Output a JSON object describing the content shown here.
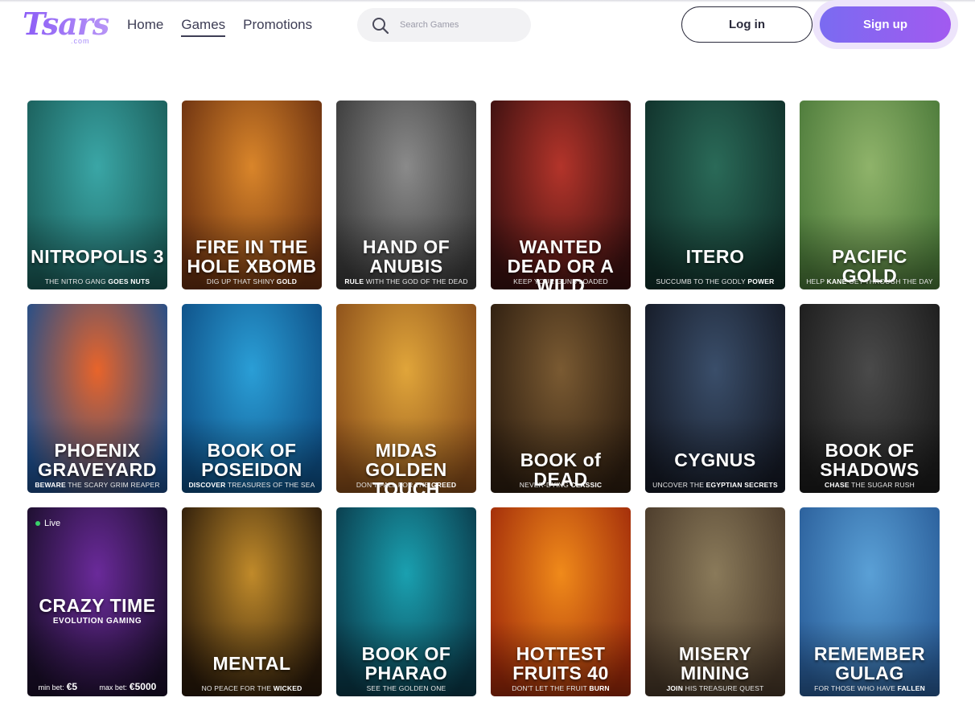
{
  "header": {
    "logo": {
      "text": "Tsars",
      "sub": ".com"
    },
    "nav": [
      {
        "label": "Home",
        "active": false
      },
      {
        "label": "Games",
        "active": true
      },
      {
        "label": "Promotions",
        "active": false
      }
    ],
    "search": {
      "placeholder": "Search Games",
      "icon": "search-icon"
    },
    "login_label": "Log in",
    "signup_label": "Sign up"
  },
  "colors": {
    "accent": "#8b5cf6",
    "signup_start": "#7a6bf1",
    "signup_end": "#a25af0"
  },
  "games": [
    {
      "title": "NITROPOLIS 3",
      "tag_pre": "THE NITRO GANG ",
      "tag_bold": "GOES NUTS",
      "tag_post": "",
      "bg1": "#3aa6a6",
      "bg2": "#1b5e5a"
    },
    {
      "title": "FIRE IN THE HOLE XBOMB",
      "tag_pre": "DIG UP THAT SHINY ",
      "tag_bold": "GOLD",
      "tag_post": "",
      "bg1": "#d9852a",
      "bg2": "#6a3010"
    },
    {
      "title": "HAND OF ANUBIS",
      "tag_pre": "",
      "tag_bold": "RULE",
      "tag_post": " WITH THE GOD OF THE DEAD",
      "bg1": "#8a8a8a",
      "bg2": "#3a3a3a"
    },
    {
      "title": "WANTED DEAD OR A WILD",
      "tag_pre": "KEEP YOUR GUNS LOADED",
      "tag_bold": "",
      "tag_post": "",
      "bg1": "#b3342a",
      "bg2": "#3a1010"
    },
    {
      "title": "ITERO",
      "tag_pre": "SUCCUMB TO THE GODLY ",
      "tag_bold": "POWER",
      "tag_post": "",
      "bg1": "#2a6a58",
      "bg2": "#10302a"
    },
    {
      "title": "PACIFIC GOLD",
      "tag_pre": "HELP ",
      "tag_bold": "KANE",
      "tag_post": " GET THROUGH THE DAY",
      "bg1": "#8fb36a",
      "bg2": "#4c7a3a"
    },
    {
      "title": "PHOENIX GRAVEYARD",
      "tag_pre": "",
      "tag_bold": "BEWARE",
      "tag_post": " THE SCARY GRIM REAPER",
      "bg1": "#e8642a",
      "bg2": "#1e4e8c"
    },
    {
      "title": "BOOK OF POSEIDON",
      "tag_pre": "",
      "tag_bold": "DISCOVER",
      "tag_post": " TREASURES OF THE SEA",
      "bg1": "#2a9ed6",
      "bg2": "#0e4f86"
    },
    {
      "title": "MIDAS GOLDEN TOUCH",
      "tag_pre": "DON'T FALL FOR THE ",
      "tag_bold": "GREED",
      "tag_post": "",
      "bg1": "#e0a53a",
      "bg2": "#8a4e1a"
    },
    {
      "title": "BOOK of DEAD",
      "tag_pre": "NEVER-DYING ",
      "tag_bold": "CLASSIC",
      "tag_post": "",
      "bg1": "#7a5a32",
      "bg2": "#2e1e10"
    },
    {
      "title": "CYGNUS",
      "tag_pre": "UNCOVER THE ",
      "tag_bold": "EGYPTIAN SECRETS",
      "tag_post": "",
      "bg1": "#3a4e6a",
      "bg2": "#151a26"
    },
    {
      "title": "BOOK OF SHADOWS",
      "tag_pre": "",
      "tag_bold": "CHASE",
      "tag_post": " THE SUGAR RUSH",
      "bg1": "#4a4a4a",
      "bg2": "#1c1c1c"
    },
    {
      "title": "CRAZY TIME",
      "sub": "EVOLUTION GAMING",
      "live": "Live",
      "minbet_label": "min bet:",
      "minbet": "€5",
      "maxbet_label": "max bet:",
      "maxbet": "€5000",
      "bg1": "#6a2a9a",
      "bg2": "#1a0e2a"
    },
    {
      "title": "MENTAL",
      "tag_pre": "NO PEACE FOR THE ",
      "tag_bold": "WICKED",
      "tag_post": "",
      "bg1": "#c08a2a",
      "bg2": "#2a1a0a"
    },
    {
      "title": "BOOK OF PHARAO",
      "tag_pre": "SEE THE GOLDEN ONE",
      "tag_bold": "",
      "tag_post": "",
      "bg1": "#1aa0b0",
      "bg2": "#0a3a4a"
    },
    {
      "title": "HOTTEST FRUITS 40",
      "tag_pre": "DON'T LET THE FRUIT ",
      "tag_bold": "BURN",
      "tag_post": "",
      "bg1": "#f08a1a",
      "bg2": "#a02a0a"
    },
    {
      "title": "MISERY MINING",
      "tag_pre": "",
      "tag_bold": "JOIN",
      "tag_post": " HIS TREASURE QUEST",
      "bg1": "#8a7a5a",
      "bg2": "#4a3a2a"
    },
    {
      "title": "REMEMBER GULAG",
      "tag_pre": "FOR THOSE WHO HAVE ",
      "tag_bold": "FALLEN",
      "tag_post": "",
      "bg1": "#5aa0d6",
      "bg2": "#2a5e9a"
    }
  ]
}
